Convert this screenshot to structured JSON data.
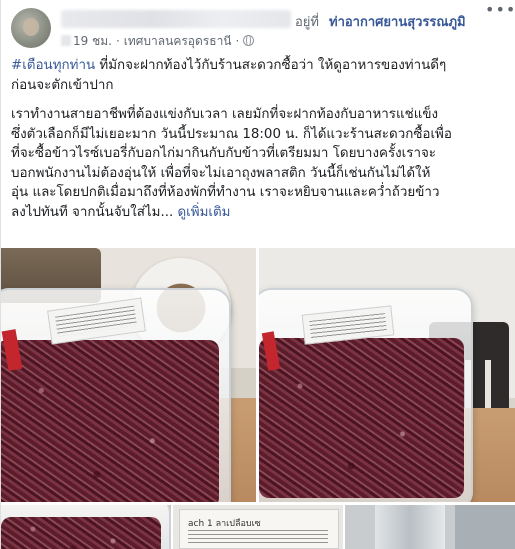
{
  "post": {
    "header": {
      "at_text": "อยู่ที่",
      "place": "ท่าอากาศยานสุวรรณภูมิ",
      "time": "19 ชม.",
      "location": "เทศบาลนครอุดรธานี",
      "more": "•••"
    },
    "text": {
      "hashtag": "#เตือนทุกท่าน",
      "para1_rest_line1": " ที่มักจะฝากท้องไว้กับร้านสะดวกซื้อว่า ให้ดูอาหารของท่านดีๆ",
      "para1_line2": "ก่อนจะตักเข้าปาก",
      "para2_lines": [
        "เราทำงานสายอาชีพที่ต้องแข่งกับเวลา เลยมักที่จะฝากท้องกับอาหารแช่แข็ง",
        "ซึ่งตัวเลือกก็มีไม่เยอะมาก วันนี้ประมาณ 18:00 น. ก็ได้แวะร้านสะดวกซื้อเพื่อ",
        "ที่จะซื้อข้าวไรซ์เบอรี่กับอกไก่มากินกับกับข้าวที่เตรียมมา โดยบางครั้งเราจะ",
        "บอกพนักงานไม่ต้องอุ่นให้ เพื่อที่จะไม่เอาถุงพลาสติก วันนี้ก็เช่นกันไม่ได้ให้",
        "อุ่น และโดยปกติเมื่อมาถึงที่ห้องพักที่ทำงาน เราจะหยิบจานและคว่ำถ้วยข้าว"
      ],
      "para2_last": "ลงไปทันที จากนั้นจับใส่ไม...",
      "see_more": "ดูเพิ่มเติม"
    },
    "photos": {
      "label_text": "ach 1 ลาเปลือบเซ"
    }
  },
  "colors": {
    "link": "#385898",
    "secondary_text": "#606770",
    "rice": "#5a1c29"
  }
}
